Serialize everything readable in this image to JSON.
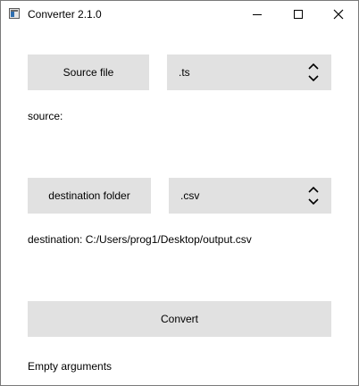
{
  "window": {
    "title": "Converter 2.1.0"
  },
  "source": {
    "button_label": "Source file",
    "format_selected": ".ts",
    "path_label": "source:"
  },
  "destination": {
    "button_label": "destination folder",
    "format_selected": ".csv",
    "path_label": "destination: C:/Users/prog1/Desktop/output.csv"
  },
  "convert": {
    "button_label": "Convert"
  },
  "status": {
    "message": "Empty arguments"
  },
  "icons": [
    "app-icon",
    "minimize-icon",
    "maximize-icon",
    "close-icon",
    "chevron-updown-icon"
  ]
}
